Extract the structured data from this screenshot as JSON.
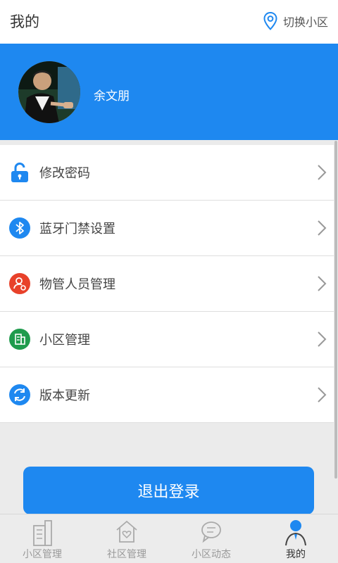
{
  "header": {
    "title": "我的",
    "switch_label": "切换小区"
  },
  "profile": {
    "name": "余文朋"
  },
  "menu": [
    {
      "label": "修改密码",
      "icon": "unlock-icon",
      "color": "#1e88f0"
    },
    {
      "label": "蓝牙门禁设置",
      "icon": "bluetooth-icon",
      "color": "#1e88f0"
    },
    {
      "label": "物管人员管理",
      "icon": "user-manage-icon",
      "color": "#e8412a"
    },
    {
      "label": "小区管理",
      "icon": "building-icon",
      "color": "#1f9b4d"
    },
    {
      "label": "版本更新",
      "icon": "refresh-icon",
      "color": "#1e88f0"
    }
  ],
  "logout_label": "退出登录",
  "tabs": [
    {
      "label": "小区管理",
      "icon": "building-tab-icon"
    },
    {
      "label": "社区管理",
      "icon": "house-heart-icon"
    },
    {
      "label": "小区动态",
      "icon": "chat-bubble-icon"
    },
    {
      "label": "我的",
      "icon": "person-icon",
      "active": true
    }
  ]
}
